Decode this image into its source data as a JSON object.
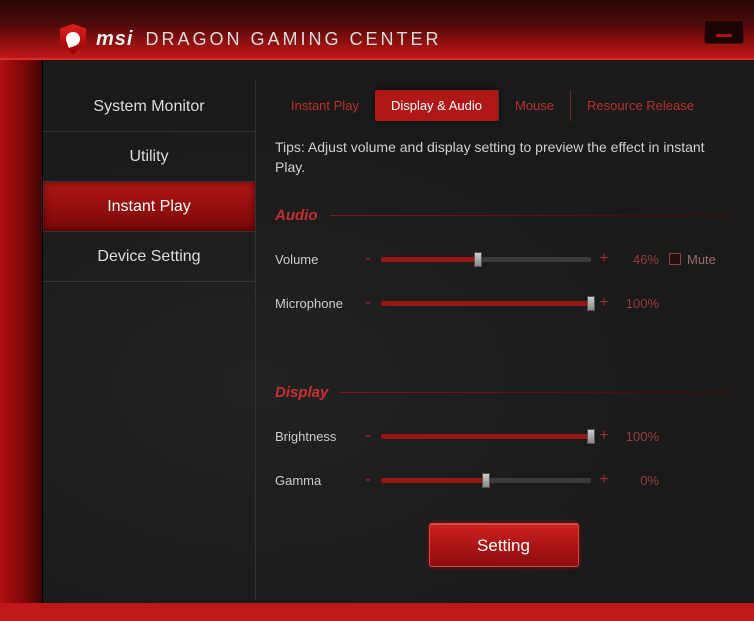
{
  "brand": "msi",
  "app_title": "DRAGON GAMING CENTER",
  "sidebar": {
    "items": [
      {
        "label": "System Monitor"
      },
      {
        "label": "Utility"
      },
      {
        "label": "Instant Play"
      },
      {
        "label": "Device Setting"
      }
    ],
    "active_index": 2
  },
  "tabs": {
    "items": [
      {
        "label": "Instant Play"
      },
      {
        "label": "Display & Audio"
      },
      {
        "label": "Mouse"
      },
      {
        "label": "Resource Release"
      }
    ],
    "active_index": 1
  },
  "tips": "Tips: Adjust volume and display setting to preview the effect in instant Play.",
  "sections": {
    "audio": {
      "title": "Audio",
      "volume": {
        "label": "Volume",
        "percent": 46,
        "display": "46%"
      },
      "microphone": {
        "label": "Microphone",
        "percent": 100,
        "display": "100%"
      },
      "mute": {
        "label": "Mute",
        "checked": false
      }
    },
    "display": {
      "title": "Display",
      "brightness": {
        "label": "Brightness",
        "percent": 100,
        "display": "100%"
      },
      "gamma": {
        "label": "Gamma",
        "percent": 50,
        "display": "0%"
      }
    }
  },
  "setting_button": "Setting",
  "controls": {
    "minus": "-",
    "plus": "+"
  }
}
